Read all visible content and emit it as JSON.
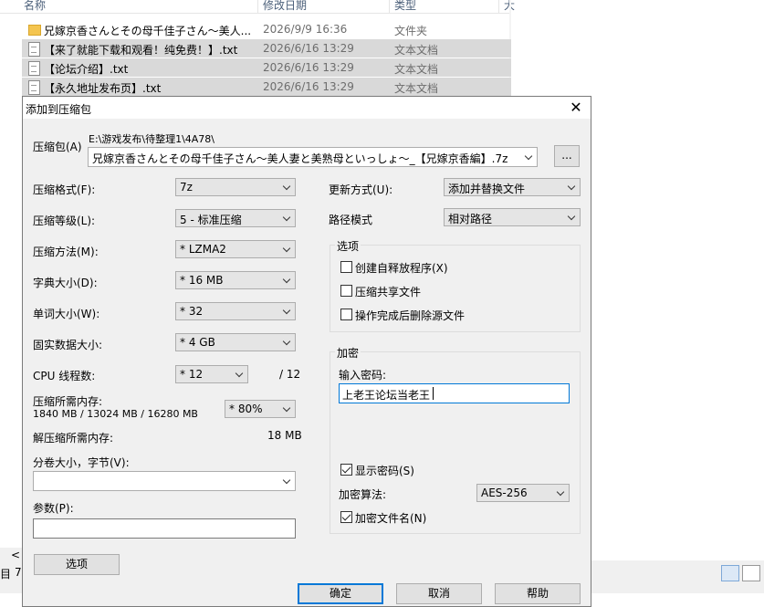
{
  "explorer": {
    "headers": {
      "name": "名称",
      "date": "修改日期",
      "type": "类型"
    },
    "rows": [
      {
        "name": "兄嫁京香さんとその母千佳子さん～美人...",
        "date": "2026/9/9 16:36",
        "type": "文件夹",
        "icon": "folder-icon",
        "selected": false
      },
      {
        "name": "【来了就能下载和观看！纯免费！】.txt",
        "date": "2026/6/16 13:29",
        "type": "文本文档",
        "icon": "text-file-icon",
        "selected": true
      },
      {
        "name": "【论坛介绍】.txt",
        "date": "2026/6/16 13:29",
        "type": "文本文档",
        "icon": "text-file-icon",
        "selected": true
      },
      {
        "name": "【永久地址发布页】.txt",
        "date": "2026/6/16 13:29",
        "type": "文本文档",
        "icon": "text-file-icon",
        "selected": true
      }
    ],
    "left_fragments": {
      "a": "<",
      "b": "目",
      "c": "7"
    }
  },
  "dialog": {
    "title": "添加到压缩包",
    "archive": {
      "label": "压缩包(A)",
      "path": "E:\\游戏发布\\待整理1\\4A78\\",
      "filename": "兄嫁京香さんとその母千佳子さん～美人妻と美熟母といっしょ～_【兄嫁京香編】.7z",
      "browse": "..."
    },
    "left": {
      "format": {
        "label": "压缩格式(F):",
        "value": "7z"
      },
      "level": {
        "label": "压缩等级(L):",
        "value": "5 - 标准压缩"
      },
      "method": {
        "label": "压缩方法(M):",
        "value": "* LZMA2"
      },
      "dict": {
        "label": "字典大小(D):",
        "value": "* 16 MB"
      },
      "word": {
        "label": "单词大小(W):",
        "value": "* 32"
      },
      "solid": {
        "label": "固实数据大小:",
        "value": "* 4 GB"
      },
      "threads": {
        "label": "CPU 线程数:",
        "value": "* 12",
        "max": "/ 12"
      },
      "mem_comp": {
        "label": "压缩所需内存:",
        "detail": "1840 MB / 13024 MB / 16280 MB",
        "value": "* 80%"
      },
      "mem_decomp": {
        "label": "解压缩所需内存:",
        "value": "18 MB"
      },
      "volume": {
        "label": "分卷大小，字节(V):",
        "value": ""
      },
      "params": {
        "label": "参数(P):",
        "value": ""
      },
      "options_btn": "选项"
    },
    "right": {
      "update": {
        "label": "更新方式(U):",
        "value": "添加并替换文件"
      },
      "pathmode": {
        "label": "路径模式",
        "value": "相对路径"
      },
      "options": {
        "title": "选项",
        "sfx": {
          "label": "创建自释放程序(X)",
          "checked": false
        },
        "shared": {
          "label": "压缩共享文件",
          "checked": false
        },
        "delete": {
          "label": "操作完成后删除源文件",
          "checked": false
        }
      },
      "encryption": {
        "title": "加密",
        "pwd_label": "输入密码:",
        "pwd_value": "上老王论坛当老王",
        "show": {
          "label": "显示密码(S)",
          "checked": true
        },
        "method_label": "加密算法:",
        "method_value": "AES-256",
        "names": {
          "label": "加密文件名(N)",
          "checked": true
        }
      }
    },
    "buttons": {
      "ok": "确定",
      "cancel": "取消",
      "help": "帮助"
    }
  }
}
